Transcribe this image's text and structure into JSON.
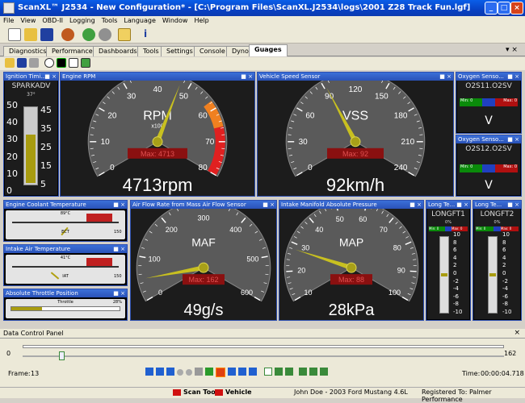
{
  "window": {
    "title": "ScanXL™ J2534 - New Configuration* - [C:\\Program Files\\ScanXL.J2534\\logs\\2001 Z28 Track Fun.lgf]"
  },
  "menu": [
    "File",
    "View",
    "OBD-II",
    "Logging",
    "Tools",
    "Language",
    "Window",
    "Help"
  ],
  "tabs": [
    "Diagnostics",
    "Performance",
    "Dashboards",
    "Tools",
    "Settings",
    "Console",
    "Dyno",
    "Guages"
  ],
  "gauges": {
    "timing": {
      "title": "Ignition Timi...",
      "label": "SPARKADV",
      "value": "37°",
      "scale_left": [
        "50",
        "40",
        "30",
        "20",
        "10",
        "0"
      ],
      "scale_right": [
        "45",
        "35",
        "25",
        "15",
        "5"
      ],
      "level": 0.62
    },
    "rpm": {
      "title": "Engine RPM",
      "unit": "RPM",
      "mult": "x100",
      "ticks": [
        "0",
        "10",
        "20",
        "30",
        "40",
        "50",
        "60",
        "70",
        "80"
      ],
      "max": "Max: 4713",
      "readout": "4713rpm",
      "value": 47.13,
      "min": 0,
      "maxv": 80
    },
    "vss": {
      "title": "Vehicle Speed Sensor",
      "unit": "VSS",
      "ticks": [
        "0",
        "30",
        "60",
        "90",
        "120",
        "150",
        "180",
        "210",
        "240"
      ],
      "max": "Max: 92",
      "readout": "92km/h",
      "value": 92,
      "min": 0,
      "maxv": 240
    },
    "o2s11": {
      "title": "Oxygen Senso...",
      "label": "O2S11.O2SV",
      "min": "Min: 0",
      "max": "Max: 0",
      "unit": "V"
    },
    "o2s12": {
      "title": "Oxygen Senso...",
      "label": "O2S12.O2SV",
      "min": "Min: 0",
      "max": "Max: 0",
      "unit": "V"
    },
    "ect": {
      "title": "Engine Coolant Temperature",
      "value": "89°C",
      "label": "ECT",
      "scale_max": "150"
    },
    "iat": {
      "title": "Intake Air Temperature",
      "value": "41°C",
      "label": "IAT",
      "scale_max": "150"
    },
    "tp": {
      "title": "Absolute Throttle Position",
      "value": "28%",
      "label": "Throttle"
    },
    "maf": {
      "title": "Air Flow Rate from Mass Air Flow Sensor",
      "unit": "MAF",
      "ticks": [
        "0",
        "100",
        "200",
        "300",
        "400",
        "500",
        "600"
      ],
      "max": "Max: 162",
      "readout": "49g/s",
      "value": 49,
      "min": 0,
      "maxv": 600
    },
    "map": {
      "title": "Intake Manifold Absolute Pressure",
      "unit": "MAP",
      "ticks": [
        "10",
        "20",
        "30",
        "40",
        "50",
        "60",
        "70",
        "80",
        "90",
        "100"
      ],
      "max": "Max: 88",
      "readout": "28kPa",
      "value": 28,
      "min": 10,
      "maxv": 100
    },
    "ltft1": {
      "title": "Long Te...",
      "label": "LONGFT1",
      "value": "0%",
      "min": "Min: 0",
      "max": "Max: 0",
      "scale": [
        "10",
        "8",
        "6",
        "4",
        "2",
        "0",
        "-2",
        "-4",
        "-6",
        "-8",
        "-10"
      ]
    },
    "ltft2": {
      "title": "Long Te...",
      "label": "LONGFT2",
      "value": "0%",
      "min": "Min: 0",
      "max": "Max: 0",
      "scale": [
        "10",
        "8",
        "6",
        "4",
        "2",
        "0",
        "-2",
        "-4",
        "-6",
        "-8",
        "-10"
      ]
    }
  },
  "data_control": {
    "title": "Data Control Panel",
    "min": "0",
    "max": "162",
    "frame_label": "Frame:",
    "frame": "13",
    "time_label": "Time:",
    "time": "00:00:04.718",
    "position": 0.08
  },
  "status": {
    "scan_tool": "Scan Tool",
    "vehicle": "Vehicle",
    "user": "John Doe - 2003 Ford Mustang 4.6L",
    "registered": "Registered To: Palmer Performance"
  },
  "colors": {
    "title_blue": "#0842c4",
    "panel_header": "#2a52b8",
    "needle": "#c8c020",
    "max_box": "#8a1010"
  }
}
